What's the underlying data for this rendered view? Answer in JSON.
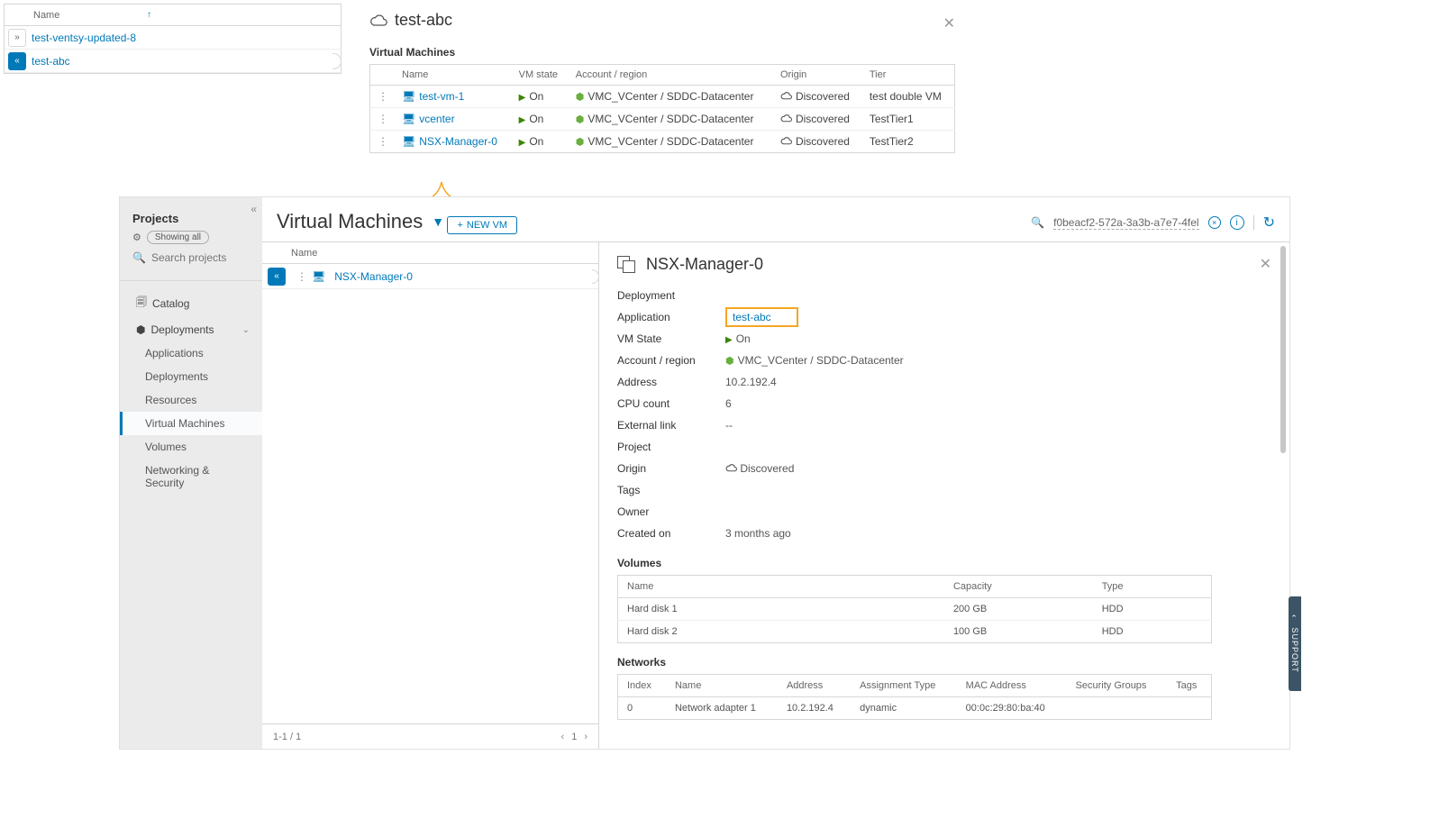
{
  "topList": {
    "header": "Name",
    "rows": [
      {
        "label": "test-ventsy-updated-8",
        "selected": false
      },
      {
        "label": "test-abc",
        "selected": true
      }
    ]
  },
  "topDetail": {
    "title": "test-abc",
    "subhead": "Virtual Machines",
    "columns": {
      "name": "Name",
      "state": "VM state",
      "account": "Account / region",
      "origin": "Origin",
      "tier": "Tier"
    },
    "rows": [
      {
        "name": "test-vm-1",
        "state": "On",
        "account": "VMC_VCenter / SDDC-Datacenter",
        "origin": "Discovered",
        "tier": "test double VM"
      },
      {
        "name": "vcenter",
        "state": "On",
        "account": "VMC_VCenter / SDDC-Datacenter",
        "origin": "Discovered",
        "tier": "TestTier1"
      },
      {
        "name": "NSX-Manager-0",
        "state": "On",
        "account": "VMC_VCenter / SDDC-Datacenter",
        "origin": "Discovered",
        "tier": "TestTier2"
      }
    ]
  },
  "sidebar": {
    "heading": "Projects",
    "showingAll": "Showing all",
    "searchPlaceholder": "Search projects",
    "items": {
      "catalog": "Catalog",
      "deployments": "Deployments",
      "applications": "Applications",
      "deployments_sub": "Deployments",
      "resources": "Resources",
      "virtualMachines": "Virtual Machines",
      "volumes": "Volumes",
      "networking": "Networking & Security"
    }
  },
  "main": {
    "title": "Virtual Machines",
    "newVm": "NEW VM",
    "guid": "f0beacf2-572a-3a3b-a7e7-4fel",
    "list": {
      "header": "Name",
      "rows": [
        {
          "name": "NSX-Manager-0"
        }
      ],
      "footerCount": "1-1 / 1",
      "page": "1"
    }
  },
  "detail": {
    "title": "NSX-Manager-0",
    "props": {
      "deployment_k": "Deployment",
      "deployment_v": "",
      "application_k": "Application",
      "application_v": "test-abc",
      "vmstate_k": "VM State",
      "vmstate_v": "On",
      "account_k": "Account / region",
      "account_v": "VMC_VCenter / SDDC-Datacenter",
      "address_k": "Address",
      "address_v": "10.2.192.4",
      "cpu_k": "CPU count",
      "cpu_v": "6",
      "extlink_k": "External link",
      "extlink_v": "--",
      "project_k": "Project",
      "project_v": "",
      "origin_k": "Origin",
      "origin_v": "Discovered",
      "tags_k": "Tags",
      "tags_v": "",
      "owner_k": "Owner",
      "owner_v": "",
      "created_k": "Created on",
      "created_v": "3 months ago"
    },
    "volumes": {
      "heading": "Volumes",
      "cols": {
        "name": "Name",
        "capacity": "Capacity",
        "type": "Type"
      },
      "rows": [
        {
          "name": "Hard disk 1",
          "capacity": "200 GB",
          "type": "HDD"
        },
        {
          "name": "Hard disk 2",
          "capacity": "100 GB",
          "type": "HDD"
        }
      ]
    },
    "networks": {
      "heading": "Networks",
      "cols": {
        "index": "Index",
        "name": "Name",
        "address": "Address",
        "assign": "Assignment Type",
        "mac": "MAC Address",
        "sg": "Security Groups",
        "tags": "Tags"
      },
      "rows": [
        {
          "index": "0",
          "name": "Network adapter 1",
          "address": "10.2.192.4",
          "assign": "dynamic",
          "mac": "00:0c:29:80:ba:40",
          "sg": "",
          "tags": ""
        }
      ]
    }
  },
  "support": "SUPPORT"
}
